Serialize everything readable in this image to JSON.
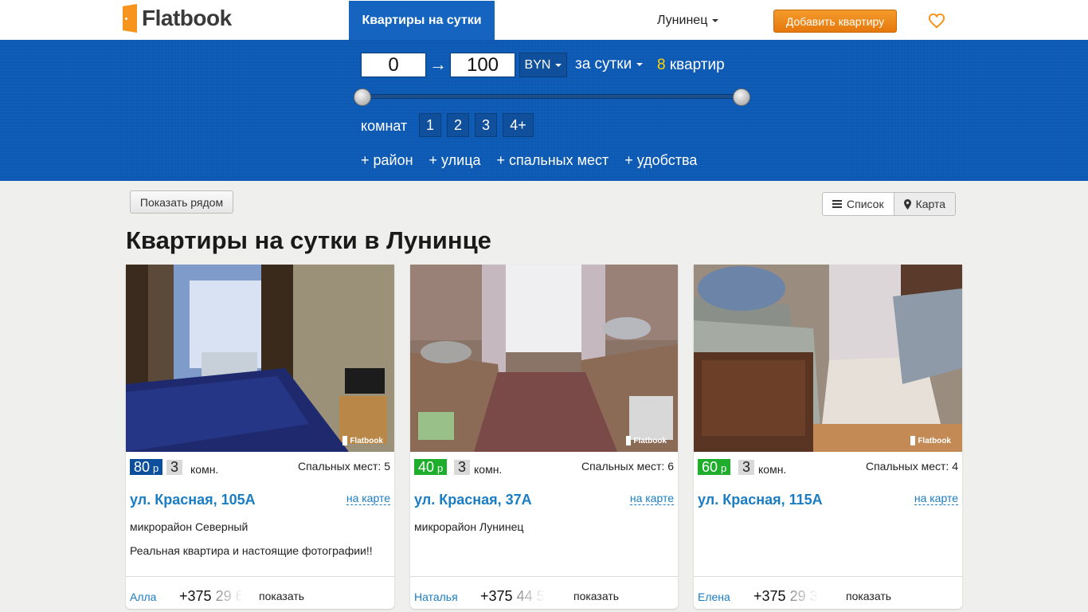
{
  "header": {
    "logo": "Flatbook",
    "nav_tab": "Квартиры на сутки",
    "city": "Лунинец",
    "add_button": "Добавить квартиру"
  },
  "filter": {
    "price_min": "0",
    "price_max": "100",
    "arrow": "→",
    "currency": "BYN",
    "period": "за сутки",
    "count_num": "8",
    "count_label": "квартир",
    "rooms_label": "комнат",
    "rooms": [
      "1",
      "2",
      "3",
      "4+"
    ],
    "extra": [
      "+ район",
      "+ улица",
      "+ спальных мест",
      "+ удобства"
    ],
    "slider_min_fraction": 0,
    "slider_max_fraction": 1
  },
  "toolbar": {
    "near_button": "Показать рядом",
    "list_view": "Список",
    "map_view": "Карта"
  },
  "page_title": "Квартиры на сутки в Лунинце",
  "colors": {
    "brand_blue": "#0d5ab4",
    "accent_orange": "#f7941d",
    "price_dark": "#0d4f9c",
    "price_green": "#1fae2b"
  },
  "listings": [
    {
      "price": "80",
      "currency": "р",
      "price_color": "#0d4f9c",
      "rooms": "3",
      "rooms_label": "комн.",
      "beds": "Спальных мест: 5",
      "address": "ул. Красная, 105А",
      "map_link": "на карте",
      "district": "микрорайон Северный",
      "description": "Реальная квартира и настоящие фотографии!!",
      "owner": "Алла",
      "phone_visible": "+375",
      "phone_faded": "29 6",
      "show_label": "показать",
      "watermark": "Flatbook"
    },
    {
      "price": "40",
      "currency": "р",
      "price_color": "#1fae2b",
      "rooms": "3",
      "rooms_label": "комн.",
      "beds": "Спальных мест: 6",
      "address": "ул. Красная, 37А",
      "map_link": "на карте",
      "district": "микрорайон Лунинец",
      "description": "",
      "owner": "Наталья",
      "phone_visible": "+375",
      "phone_faded": "44 5",
      "show_label": "показать",
      "watermark": "Flatbook"
    },
    {
      "price": "60",
      "currency": "р",
      "price_color": "#1fae2b",
      "rooms": "3",
      "rooms_label": "комн.",
      "beds": "Спальных мест: 4",
      "address": "ул. Красная, 115А",
      "map_link": "на карте",
      "district": "",
      "description": "",
      "owner": "Елена",
      "phone_visible": "+375",
      "phone_faded": "29 3",
      "show_label": "показать",
      "watermark": "Flatbook"
    }
  ]
}
